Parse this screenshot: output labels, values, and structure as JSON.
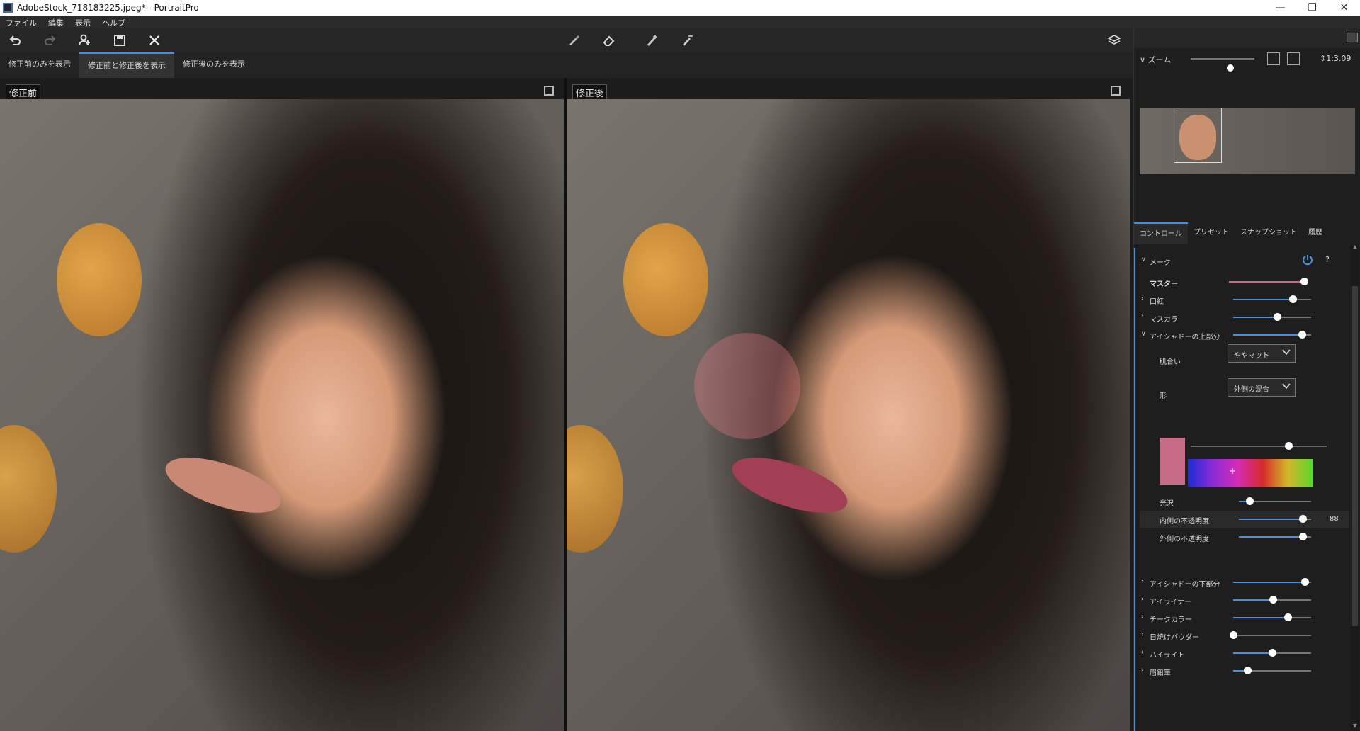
{
  "window": {
    "title": "AdobeStock_718183225.jpeg* - PortraitPro",
    "minimize": "—",
    "maximize": "❐",
    "close": "✕"
  },
  "menu": [
    "ファイル",
    "編集",
    "表示",
    "ヘルプ"
  ],
  "view_tabs": [
    {
      "label": "修正前のみを表示",
      "active": false
    },
    {
      "label": "修正前と修正後を表示",
      "active": true
    },
    {
      "label": "修正後のみを表示",
      "active": false
    }
  ],
  "panes": {
    "before_label": "修正前",
    "after_label": "修正後"
  },
  "zoom": {
    "label": "ズーム",
    "value": "1:3.09",
    "level": 0.6
  },
  "right_tabs": [
    {
      "label": "コントロール",
      "active": true
    },
    {
      "label": "プリセット",
      "active": false
    },
    {
      "label": "スナップショット",
      "active": false
    },
    {
      "label": "履歴",
      "active": false
    }
  ],
  "makeup": {
    "section_label": "メーク",
    "help": "?",
    "master": {
      "label": "マスター",
      "level": 0.96
    },
    "items_top": [
      {
        "label": "口紅",
        "level": 0.76
      },
      {
        "label": "マスカラ",
        "level": 0.56
      },
      {
        "label": "アイシャドーの上部分",
        "level": 0.88
      }
    ],
    "skin_tone": {
      "label": "肌合い",
      "value": "ややマット"
    },
    "shape": {
      "label": "形",
      "value": "外側の混合"
    },
    "color_slider_level": 0.72,
    "sub_items": [
      {
        "label": "光沢",
        "level": 0.15,
        "value": ""
      },
      {
        "label": "内側の不透明度",
        "level": 0.88,
        "value": "88"
      },
      {
        "label": "外側の不透明度",
        "level": 0.88,
        "value": ""
      }
    ],
    "items_bottom": [
      {
        "label": "アイシャドーの下部分",
        "level": 0.92
      },
      {
        "label": "アイライナー",
        "level": 0.51
      },
      {
        "label": "チークカラー",
        "level": 0.7
      },
      {
        "label": "日焼けパウダー",
        "level": 0.0
      },
      {
        "label": "ハイライト",
        "level": 0.5
      },
      {
        "label": "眉鉛筆",
        "level": 0.18
      }
    ]
  },
  "icons": {
    "undo": "undo-icon",
    "redo": "redo-icon",
    "add_person": "add-person-icon",
    "save": "save-icon",
    "close": "close-icon",
    "brush": "brush-icon",
    "eraser": "eraser-icon",
    "pen_plus": "pen-plus-icon",
    "pen_minus": "pen-minus-icon",
    "layers": "layers-icon",
    "power": "power-icon"
  },
  "colors": {
    "accent": "#4a90d9",
    "swatch": "#c76b86"
  }
}
